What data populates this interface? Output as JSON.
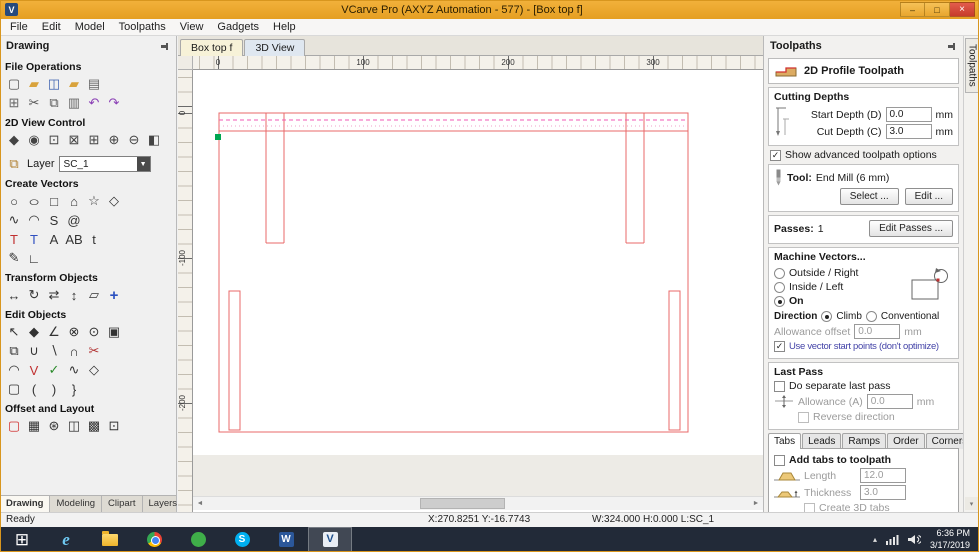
{
  "window": {
    "title": "VCarve Pro (AXYZ Automation - 577) - [Box top f]",
    "controls": {
      "minimize": "–",
      "maximize": "□",
      "close": "×"
    }
  },
  "menu": {
    "items": [
      "File",
      "Edit",
      "Model",
      "Toolpaths",
      "View",
      "Gadgets",
      "Help"
    ]
  },
  "icons": {
    "app_badge": "V",
    "dropdown_arrow": "▼",
    "layers": "⧉",
    "scroll_left": "◄",
    "scroll_right": "►",
    "scroll_down": "▾",
    "tray_up": "▴"
  },
  "colors": {
    "titlebar": "#e8a62e",
    "taskbar": "#222a38",
    "vector_red": "#e86868",
    "selected_magenta": "#f05ab4",
    "start_point_green": "#00a651"
  },
  "toolbox": {
    "panel_title": "Drawing",
    "sections": [
      {
        "label": "File Operations",
        "rows": [
          [
            {
              "n": "new-file",
              "g": "▢",
              "c": "#555"
            },
            {
              "n": "open-file",
              "g": "▰",
              "c": "#d9a33c"
            },
            {
              "n": "save-file",
              "g": "◫",
              "c": "#3a5fae"
            },
            {
              "n": "open-recent",
              "g": "▰",
              "c": "#d9a33c"
            },
            {
              "n": "print",
              "g": "▤",
              "c": "#666"
            }
          ],
          [
            {
              "n": "job-setup",
              "g": "⊞",
              "c": "#666"
            },
            {
              "n": "cut",
              "g": "✂",
              "c": "#555"
            },
            {
              "n": "copy",
              "g": "⧉",
              "c": "#555"
            },
            {
              "n": "paste",
              "g": "▥",
              "c": "#666"
            },
            {
              "n": "undo",
              "g": "↶",
              "c": "#8a3fb5"
            },
            {
              "n": "redo",
              "g": "↷",
              "c": "#8a3fb5"
            }
          ]
        ]
      },
      {
        "label": "2D View Control",
        "rows": [
          [
            {
              "n": "pan-view",
              "g": "◆",
              "c": "#444"
            },
            {
              "n": "zoom-interactive",
              "g": "◉",
              "c": "#444"
            },
            {
              "n": "zoom-box",
              "g": "⊡",
              "c": "#444"
            },
            {
              "n": "zoom-extents",
              "g": "⊠",
              "c": "#444"
            },
            {
              "n": "zoom-selection",
              "g": "⊞",
              "c": "#444"
            },
            {
              "n": "zoom-in",
              "g": "⊕",
              "c": "#444"
            },
            {
              "n": "zoom-out",
              "g": "⊖",
              "c": "#444"
            },
            {
              "n": "toggle-wireframe",
              "g": "◧",
              "c": "#444"
            }
          ]
        ]
      },
      {
        "type": "layer",
        "label": "Layer",
        "value": "SC_1"
      },
      {
        "label": "Create Vectors",
        "rows": [
          [
            {
              "n": "draw-circle",
              "g": "○",
              "c": "#333"
            },
            {
              "n": "draw-ellipse",
              "g": "○",
              "c": "#333"
            },
            {
              "n": "draw-rectangle",
              "g": "□",
              "c": "#333"
            },
            {
              "n": "draw-polygon",
              "g": "⌂",
              "c": "#333"
            },
            {
              "n": "draw-star",
              "g": "☆",
              "c": "#333"
            },
            {
              "n": "draw-shape",
              "g": "◇",
              "c": "#333"
            }
          ],
          [
            {
              "n": "draw-polyline",
              "g": "∿",
              "c": "#333"
            },
            {
              "n": "draw-arc",
              "g": "◠",
              "c": "#333"
            },
            {
              "n": "draw-curve",
              "g": "S",
              "c": "#333"
            },
            {
              "n": "draw-spiral",
              "g": "@",
              "c": "#333"
            }
          ],
          [
            {
              "n": "draw-text",
              "g": "T",
              "c": "#c03030"
            },
            {
              "n": "draw-text-box",
              "g": "T",
              "c": "#3050c0"
            },
            {
              "n": "text-on-curve",
              "g": "A",
              "c": "#333"
            },
            {
              "n": "text-spacing",
              "g": "AB",
              "c": "#333"
            },
            {
              "n": "edit-text",
              "g": "t",
              "c": "#333"
            }
          ],
          [
            {
              "n": "trace-bitmap",
              "g": "✎",
              "c": "#333"
            },
            {
              "n": "dimension",
              "g": "∟",
              "c": "#333"
            }
          ]
        ]
      },
      {
        "label": "Transform Objects",
        "rows": [
          [
            {
              "n": "move",
              "g": "↔",
              "c": "#333"
            },
            {
              "n": "rotate",
              "g": "↻",
              "c": "#333"
            },
            {
              "n": "mirror",
              "g": "⇄",
              "c": "#333"
            },
            {
              "n": "scale",
              "g": "↕",
              "c": "#333"
            },
            {
              "n": "distort",
              "g": "▱",
              "c": "#333"
            },
            {
              "n": "align",
              "g": "+",
              "c": "#2a50c0"
            }
          ]
        ]
      },
      {
        "label": "Edit Objects",
        "rows": [
          [
            {
              "n": "select",
              "g": "↖",
              "c": "#333"
            },
            {
              "n": "node-edit",
              "g": "◆",
              "c": "#333"
            },
            {
              "n": "measure",
              "g": "∠",
              "c": "#333"
            },
            {
              "n": "delete",
              "g": "⊗",
              "c": "#333"
            },
            {
              "n": "snap",
              "g": "⊙",
              "c": "#333"
            },
            {
              "n": "edit-picture",
              "g": "▣",
              "c": "#333"
            }
          ],
          [
            {
              "n": "group",
              "g": "⧉",
              "c": "#333"
            },
            {
              "n": "weld",
              "g": "∪",
              "c": "#333"
            },
            {
              "n": "subtract",
              "g": "∖",
              "c": "#333"
            },
            {
              "n": "intersect",
              "g": "∩",
              "c": "#333"
            },
            {
              "n": "trim",
              "g": "✂",
              "c": "#b03030"
            }
          ],
          [
            {
              "n": "fillet",
              "g": "◠",
              "c": "#333"
            },
            {
              "n": "join-vectors",
              "g": "V",
              "c": "#c03030"
            },
            {
              "n": "fit-curves",
              "g": "✓",
              "c": "#2a8a2a"
            },
            {
              "n": "smooth",
              "g": "∿",
              "c": "#333"
            },
            {
              "n": "node-tool",
              "g": "◇",
              "c": "#333"
            }
          ],
          [
            {
              "n": "round-ends",
              "g": "▢",
              "c": "#333"
            },
            {
              "n": "open-vector",
              "g": "(",
              "c": "#333"
            },
            {
              "n": "close-vector",
              "g": ")",
              "c": "#333"
            },
            {
              "n": "spline-edit",
              "g": "}",
              "c": "#333"
            }
          ]
        ]
      },
      {
        "label": "Offset and Layout",
        "rows": [
          [
            {
              "n": "offset",
              "g": "▢",
              "c": "#d03030"
            },
            {
              "n": "array-copy",
              "g": "▦",
              "c": "#333"
            },
            {
              "n": "copy-rotate",
              "g": "⊛",
              "c": "#333"
            },
            {
              "n": "nest",
              "g": "◫",
              "c": "#333"
            },
            {
              "n": "layout-grid",
              "g": "▩",
              "c": "#333"
            },
            {
              "n": "cluster",
              "g": "⊡",
              "c": "#333"
            }
          ]
        ]
      }
    ],
    "bottom_tabs": [
      {
        "label": "Drawing",
        "active": true
      },
      {
        "label": "Modeling",
        "active": false
      },
      {
        "label": "Clipart",
        "active": false
      },
      {
        "label": "Layers",
        "active": false
      }
    ]
  },
  "canvas": {
    "tabs": [
      {
        "label": "Box top f",
        "active": true
      },
      {
        "label": "3D View",
        "active": false
      }
    ],
    "ruler_x": [
      "0",
      "100",
      "200",
      "300"
    ],
    "ruler_y": [
      "0",
      "-100",
      "-200"
    ]
  },
  "toolpaths": {
    "panel_title": "Toolpaths",
    "header": "2D Profile Toolpath",
    "cutting_depths": {
      "title": "Cutting Depths",
      "start_label": "Start Depth (D)",
      "start_value": "0.0",
      "cut_label": "Cut Depth (C)",
      "cut_value": "3.0",
      "unit": "mm"
    },
    "advanced_option": "Show advanced toolpath options",
    "tool": {
      "label": "Tool:",
      "name": "End Mill (6 mm)",
      "select": "Select ...",
      "edit": "Edit ..."
    },
    "passes": {
      "label": "Passes:",
      "value": "1",
      "edit": "Edit Passes ..."
    },
    "machine_vectors": {
      "title": "Machine Vectors...",
      "outside": "Outside / Right",
      "inside": "Inside / Left",
      "on": "On",
      "direction_label": "Direction",
      "climb": "Climb",
      "conventional": "Conventional",
      "allowance_label": "Allowance offset",
      "allowance_value": "0.0",
      "unit": "mm",
      "start_points": "Use vector start points (don't optimize)"
    },
    "last_pass": {
      "title": "Last Pass",
      "separate": "Do separate last pass",
      "allowance_label": "Allowance (A)",
      "allowance_value": "0.0",
      "unit": "mm",
      "reverse": "Reverse direction"
    },
    "tabs": {
      "labels": [
        "Tabs",
        "Leads",
        "Ramps",
        "Order",
        "Corners"
      ],
      "active": "Tabs",
      "add_tabs": "Add tabs to toolpath",
      "length_label": "Length",
      "length_value": "12.0",
      "thickness_label": "Thickness",
      "thickness_value": "3.0",
      "create_3d": "Create 3D tabs"
    }
  },
  "side_tab": "Toolpaths",
  "status": {
    "ready": "Ready",
    "cursor": "X:270.8251 Y:-16.7743",
    "selection": "W:324.000 H:0.000 L:SC_1"
  },
  "taskbar": {
    "items": [
      {
        "name": "start",
        "glyph": "⊞",
        "fg": "#ffffff"
      },
      {
        "name": "internet-explorer",
        "glyph": "e",
        "fg": "#6fc9f2"
      },
      {
        "name": "file-explorer",
        "glyph": "",
        "fg": ""
      },
      {
        "name": "chrome",
        "glyph": "",
        "fg": ""
      },
      {
        "name": "green-app",
        "glyph": "",
        "fg": ""
      },
      {
        "name": "skype",
        "glyph": "S",
        "fg": "#ffffff"
      },
      {
        "name": "word",
        "glyph": "W",
        "fg": "#ffffff"
      },
      {
        "name": "vcarve",
        "glyph": "V",
        "fg": "#1d4f8c",
        "active": true
      }
    ],
    "time": "6:36 PM",
    "date": "3/17/2019"
  }
}
